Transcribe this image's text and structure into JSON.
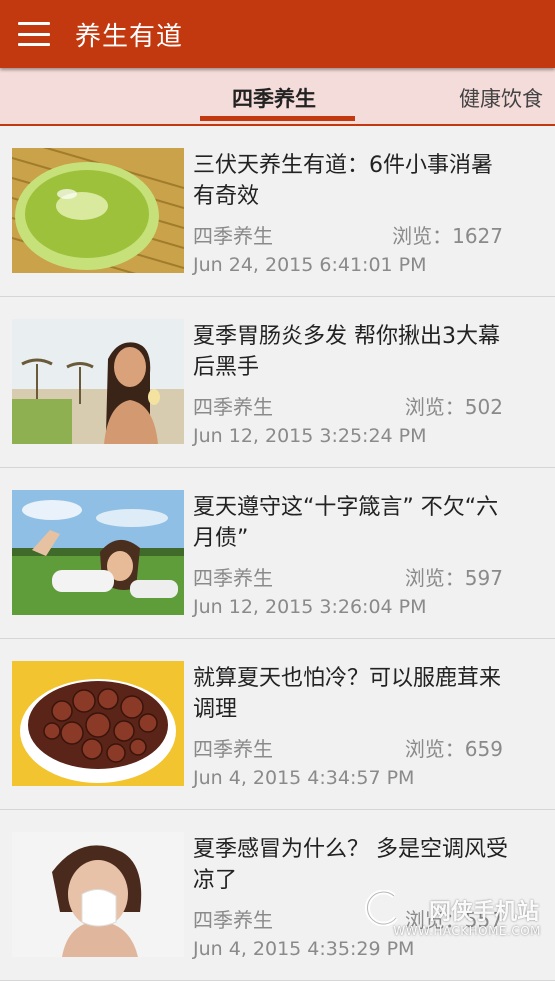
{
  "app": {
    "title": "养生有道",
    "menu_icon": "hamburger-menu-icon",
    "accent_color": "#c3390f"
  },
  "tabs": [
    {
      "label": "四季养生",
      "active": true
    },
    {
      "label": "健康饮食",
      "active": false
    }
  ],
  "articles": [
    {
      "title": "三伏天养生有道：6件小事消暑有奇效",
      "category": "四季养生",
      "views": "浏览：1627",
      "date": "Jun 24, 2015 6:41:01 PM",
      "thumbnail": "green-tea-bowl-image"
    },
    {
      "title": "夏季胃肠炎多发 帮你揪出3大幕后黑手",
      "category": "四季养生",
      "views": "浏览：502",
      "date": "Jun 12, 2015 3:25:24 PM",
      "thumbnail": "woman-ice-cream-beach-image"
    },
    {
      "title": "夏天遵守这“十字箴言” 不欠“六月债”",
      "category": "四季养生",
      "views": "浏览：597",
      "date": "Jun 12, 2015 3:26:04 PM",
      "thumbnail": "woman-lying-grass-image"
    },
    {
      "title": "就算夏天也怕冷？可以服鹿茸来调理",
      "category": "四季养生",
      "views": "浏览：659",
      "date": "Jun 4, 2015 4:34:57 PM",
      "thumbnail": "deer-antler-slices-plate-image"
    },
    {
      "title": "夏季感冒为什么？ 多是空调风受凉了",
      "category": "四季养生",
      "views": "浏览：557",
      "date": "Jun 4, 2015 4:35:29 PM",
      "thumbnail": "woman-sneezing-tissue-image"
    }
  ],
  "watermark": {
    "name": "网侠手机站",
    "url": "WWW.HACKHOME.COM"
  }
}
